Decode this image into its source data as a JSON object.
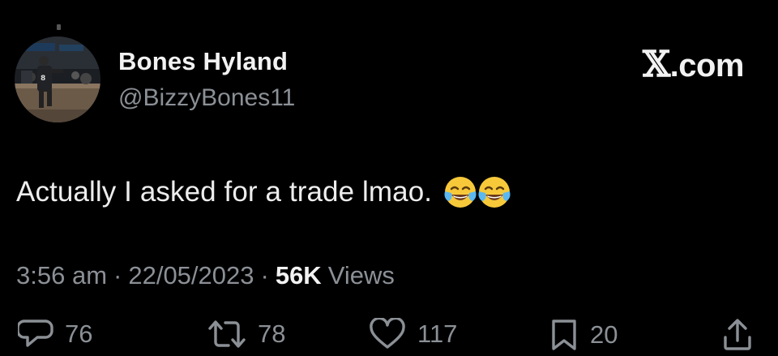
{
  "author": {
    "display_name": "Bones Hyland",
    "handle": "@BizzyBones11",
    "avatar_icon": "profile-photo-basketball-player"
  },
  "brand": {
    "x_glyph": "𝕏",
    "suffix": ".com"
  },
  "tweet": {
    "text": "Actually I asked for a trade lmao.",
    "emojis": [
      "face-with-tears-of-joy",
      "face-with-tears-of-joy"
    ]
  },
  "meta": {
    "time": "3:56 am",
    "separator": "·",
    "date": "22/05/2023",
    "views_count": "56K",
    "views_label": "Views"
  },
  "actions": {
    "replies": "76",
    "reposts": "78",
    "likes": "117",
    "bookmarks": "20"
  },
  "colors": {
    "background": "#000000",
    "primary_text": "#e7e9ea",
    "secondary_text": "#8b9096"
  }
}
